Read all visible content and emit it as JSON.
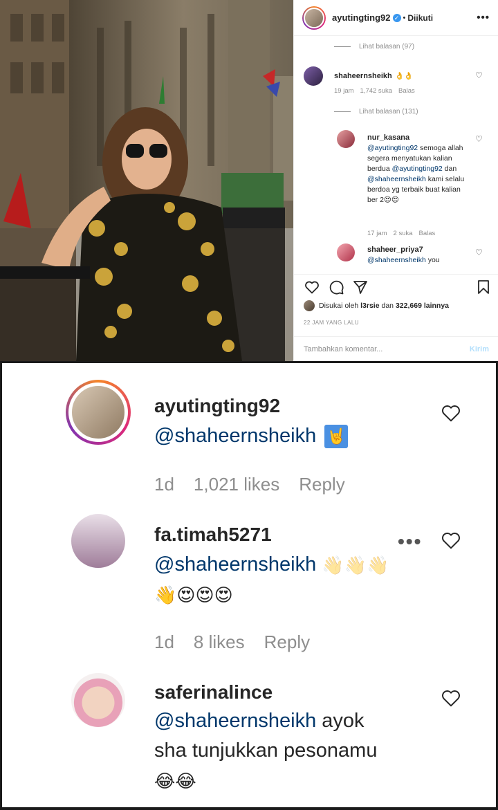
{
  "post": {
    "username": "ayutingting92",
    "follow_status": "Diikuti",
    "dot": "•",
    "verified_mark": "✓",
    "more": "•••"
  },
  "top_comments": {
    "see_replies_1": "Lihat balasan (97)",
    "c1": {
      "user": "shaheernsheikh",
      "text": "👌👌",
      "time": "19 jam",
      "likes": "1,742 suka",
      "reply": "Balas"
    },
    "see_replies_2": "Lihat balasan (131)",
    "c2": {
      "user": "nur_kasana",
      "mention1": "@ayutingting92",
      "text1": " semoga allah segera menyatukan kalian berdua ",
      "mention2": "@ayutingting92",
      "text2": " dan ",
      "mention3": "@shaheernsheikh",
      "text3": " kami selalu berdoa yg terbaik buat kalian ber 2😍😍",
      "time": "17 jam",
      "likes": "2 suka",
      "reply": "Balas"
    },
    "c3": {
      "user": "shaheer_priya7",
      "mention": "@shaheernsheikh",
      "text": " you"
    }
  },
  "liked_by": {
    "prefix": "Disukai oleh ",
    "user": "l3rsie",
    "middle": " dan ",
    "count": "322,669 lainnya"
  },
  "posted_time": "22 JAM YANG LALU",
  "add_comment": {
    "placeholder": "Tambahkan komentar...",
    "post_label": "Kirim"
  },
  "zoom_comments": [
    {
      "user": "ayutingting92",
      "mention": "@shaheernsheikh",
      "emoji": "🤘",
      "time": "1d",
      "likes": "1,021 likes",
      "reply": "Reply"
    },
    {
      "user": "fa.timah5271",
      "mention": "@shaheernsheikh",
      "emoji_line1": "👋👋👋",
      "emoji_line2": "👋😍😍😍",
      "time": "1d",
      "likes": "8 likes",
      "reply": "Reply",
      "more": "•••"
    },
    {
      "user": "saferinalince",
      "mention": "@shaheernsheikh",
      "text1": " ayok",
      "text2": "sha tunjukkan pesonamu",
      "emoji": "😂😂"
    }
  ],
  "icons": [
    "heart-icon",
    "comment-icon",
    "share-icon",
    "bookmark-icon",
    "more-icon",
    "verified-icon"
  ],
  "colors": {
    "mention": "#00376b",
    "muted": "#8e8e8e",
    "verified": "#3897f0",
    "post_disabled": "#b2dffc"
  }
}
